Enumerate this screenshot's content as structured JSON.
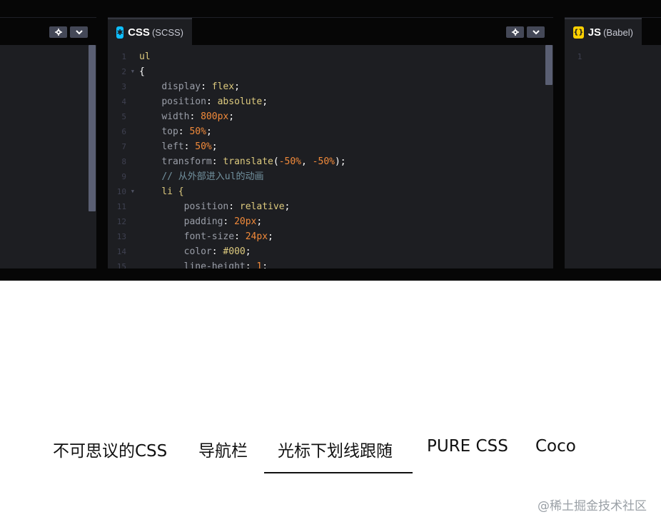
{
  "editor": {
    "css_panel": {
      "tab_name": "CSS",
      "tab_sub": "(SCSS)",
      "icon": "asterisk-icon",
      "line_numbers": [
        "1",
        "2",
        "3",
        "4",
        "5",
        "6",
        "7",
        "8",
        "9",
        "10",
        "11",
        "12",
        "13",
        "14",
        "15"
      ],
      "code": {
        "l1": "ul",
        "l2": "{",
        "l3_prop": "display",
        "l3_val": "flex",
        "l4_prop": "position",
        "l4_val": "absolute",
        "l5_prop": "width",
        "l5_val": "800px",
        "l6_prop": "top",
        "l6_val": "50%",
        "l7_prop": "left",
        "l7_val": "50%",
        "l8_prop": "transform",
        "l8_fn": "translate",
        "l8_a": "-50%",
        "l8_b": "-50%",
        "l9": "// 从外部进入ul的动画",
        "l10": "li {",
        "l11_prop": "position",
        "l11_val": "relative",
        "l12_prop": "padding",
        "l12_val": "20px",
        "l13_prop": "font-size",
        "l13_val": "24px",
        "l14_prop": "color",
        "l14_val": "#000",
        "l15_prop": "line-height",
        "l15_val": "1"
      }
    },
    "js_panel": {
      "tab_name": "JS",
      "tab_sub": "(Babel)",
      "icon": "curly-braces-icon",
      "line_numbers": [
        "1"
      ]
    },
    "header_buttons": {
      "settings_icon": "gear-icon",
      "collapse_icon": "chevron-down-icon"
    }
  },
  "preview": {
    "nav_items": [
      "不可思议的CSS",
      "导航栏",
      "光标下划线跟随",
      "PURE CSS",
      "Coco"
    ],
    "active_index": 2
  },
  "watermark": "@稀土掘金技术社区",
  "colors": {
    "editor_bg": "#1d1e22",
    "chrome_bg": "#060606",
    "css_icon": "#0ebeff",
    "js_icon": "#fcd000",
    "number": "#f28a3a",
    "selector": "#ddca7e"
  }
}
